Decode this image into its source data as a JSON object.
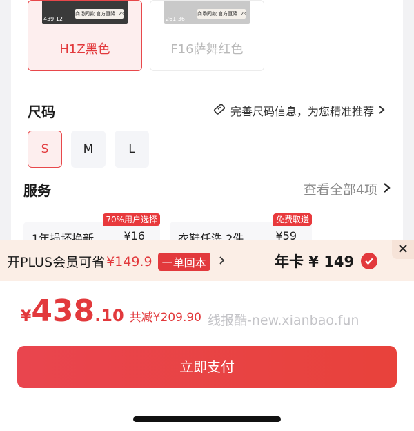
{
  "colors": [
    {
      "name": "H1Z黑色",
      "thumb_price": "439.12",
      "thumb_badge": "商场同款 官方直降12%",
      "selected": true
    },
    {
      "name": "F16萨舞红色",
      "thumb_price": "261.36",
      "thumb_badge": "商场同款 官方直降12%",
      "selected": false
    }
  ],
  "size": {
    "title": "尺码",
    "hint": "完善尺码信息，为您精准推荐",
    "options": [
      "S",
      "M",
      "L"
    ],
    "selected": "S"
  },
  "service": {
    "title": "服务",
    "view_all": "查看全部4项",
    "cards": [
      {
        "tag": "70%用户选择",
        "title": "1年损坏换新",
        "price": "¥16"
      },
      {
        "tag": "免费取送",
        "title": "衣鞋任洗 2件",
        "price": "¥59"
      }
    ]
  },
  "plus_banner": {
    "prefix": "开PLUS会员可省",
    "amount": "¥149.9",
    "pill": "一单回本",
    "right_label": "年卡 ¥ 149"
  },
  "checkout": {
    "currency": "¥",
    "price_int": "438",
    "price_dec": ".10",
    "savings": "共减¥209.90",
    "watermark": "线报酷-new.xianbao.fun",
    "pay_label": "立即支付"
  },
  "theme": {
    "accent": "#e2393c",
    "banner_bg": "#fbeee6"
  }
}
